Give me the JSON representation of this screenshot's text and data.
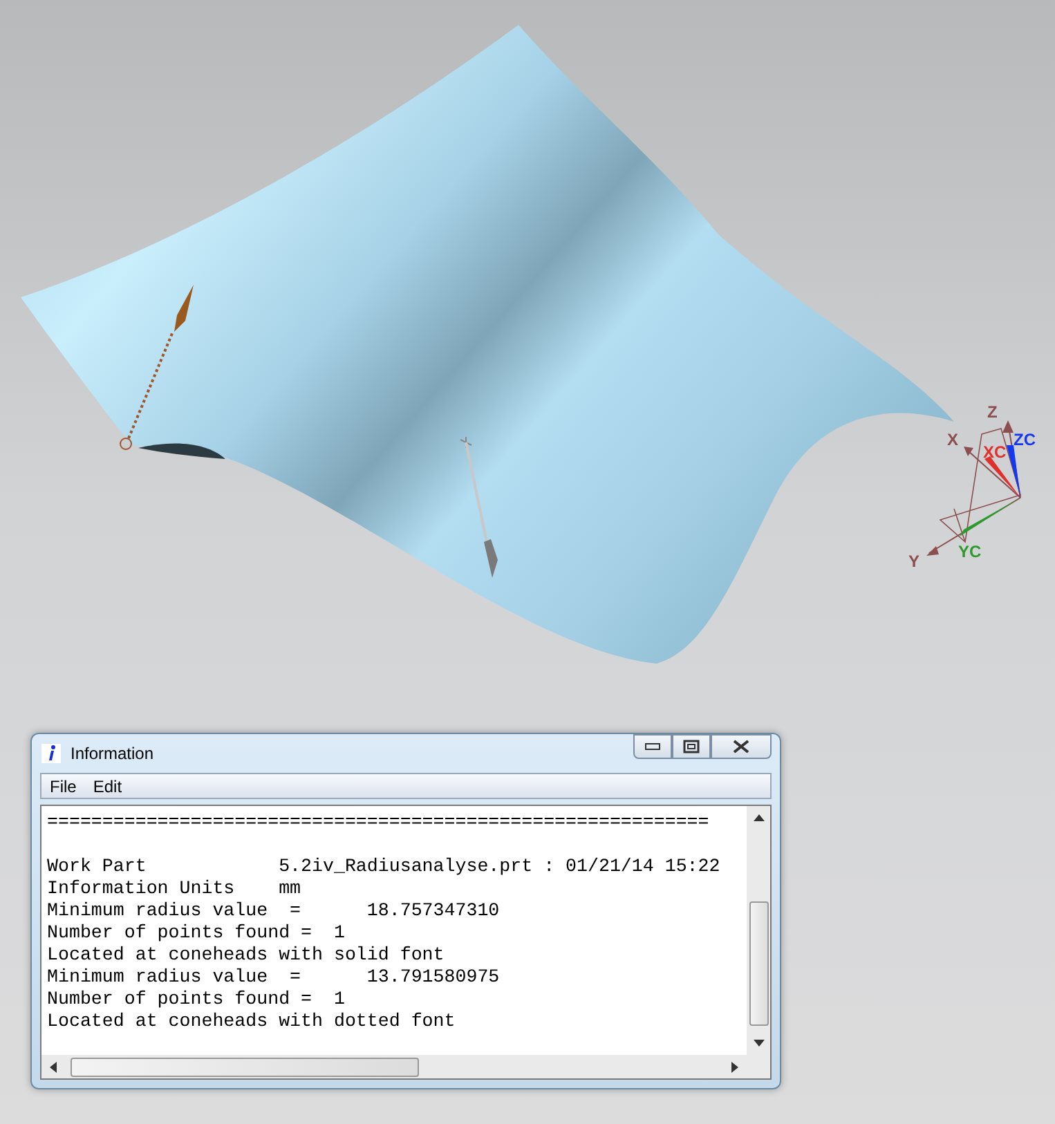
{
  "viewport": {
    "triad_labels": [
      {
        "text": "Z",
        "color": "#8c4f4f"
      },
      {
        "text": "ZC",
        "color": "#1438f0"
      },
      {
        "text": "X",
        "color": "#8c4f4f"
      },
      {
        "text": "XC",
        "color": "#e0302c"
      },
      {
        "text": "Y",
        "color": "#8c4f4f"
      },
      {
        "text": "YC",
        "color": "#2e9a2e"
      }
    ]
  },
  "info_window": {
    "title": "Information",
    "menu": [
      "File",
      "Edit"
    ],
    "lines": [
      {
        "kind": "separator",
        "text": "============================================================"
      },
      {
        "kind": "text",
        "text": "Work Part            5.2iv_Radiusanalyse.prt : 01/21/14 15:22"
      },
      {
        "kind": "text",
        "text": "Information Units    mm"
      },
      {
        "kind": "text",
        "text": "Minimum radius value  =      18.757347310"
      },
      {
        "kind": "text",
        "text": "Number of points found =  1"
      },
      {
        "kind": "text",
        "text": "Located at coneheads with solid font"
      },
      {
        "kind": "text",
        "text": "Minimum radius value  =      13.791580975"
      },
      {
        "kind": "text",
        "text": "Number of points found =  1"
      },
      {
        "kind": "text",
        "text": "Located at coneheads with dotted font"
      }
    ]
  }
}
